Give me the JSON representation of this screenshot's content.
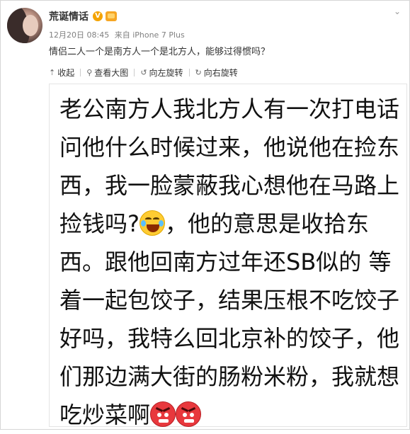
{
  "author": {
    "name": "荒诞情话",
    "verified_label": "V"
  },
  "meta": {
    "time": "12月20日 08:45",
    "source": "来自 iPhone 7 Plus"
  },
  "post": {
    "text": "情侣二人一个是南方人一个是北方人，能够过得惯吗？"
  },
  "media_actions": [
    {
      "label": "收起",
      "icon": "collapse-icon"
    },
    {
      "label": "查看大图",
      "icon": "magnify-icon"
    },
    {
      "label": "向左旋转",
      "icon": "rotate-left-icon"
    },
    {
      "label": "向右旋转",
      "icon": "rotate-right-icon"
    }
  ],
  "image_text": {
    "part1": "老公南方人我北方人有一次打电话问他什么时候过来，他说他在捡东西，我一脸蒙蔽我心想他在马路上捡钱吗?",
    "part2": "，他的意思是收拾东西。跟他回南方过年还SB似的 等着一起包饺子，结果压根不吃饺子好吗，我特么回北京补的饺子，他们那边满大街的肠粉米粉，我就想吃炒菜啊"
  },
  "colors": {
    "vip_orange": "#f4a300",
    "angry_red": "#e8383d",
    "laugh_yellow": "#ffcc33"
  }
}
